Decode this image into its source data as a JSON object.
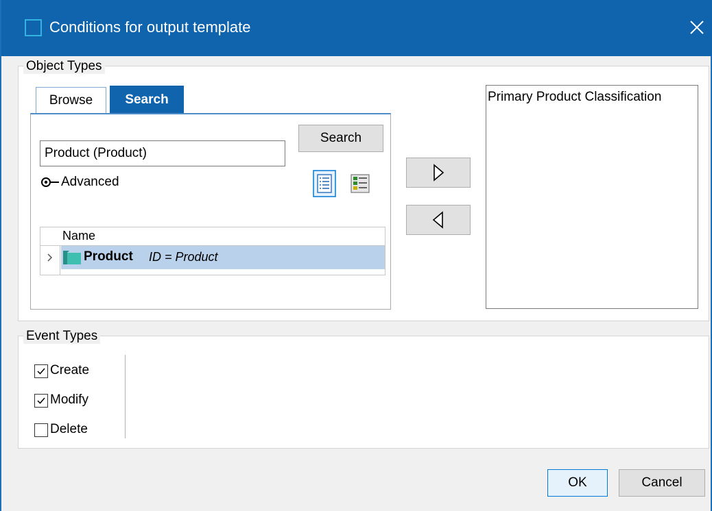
{
  "window": {
    "title": "Conditions for output template"
  },
  "object_types": {
    "legend": "Object Types",
    "tabs": [
      {
        "label": "Browse",
        "active": false
      },
      {
        "label": "Search",
        "active": true
      }
    ],
    "search_button": "Search",
    "search_value": "Product (Product)",
    "advanced_label": "Advanced",
    "grid": {
      "column_header": "Name",
      "rows": [
        {
          "name": "Product",
          "id_text": "ID = Product",
          "selected": true
        }
      ]
    },
    "selected_list": [
      "Primary Product Classification"
    ]
  },
  "event_types": {
    "legend": "Event Types",
    "options": [
      {
        "label": "Create",
        "checked": true
      },
      {
        "label": "Modify",
        "checked": true
      },
      {
        "label": "Delete",
        "checked": false
      }
    ]
  },
  "footer": {
    "ok": "OK",
    "cancel": "Cancel"
  },
  "colors": {
    "titlebar": "#0f64ad",
    "accent": "#0078d7",
    "selection": "#b9d1ea",
    "folder_icon": "#3fbfb0"
  }
}
